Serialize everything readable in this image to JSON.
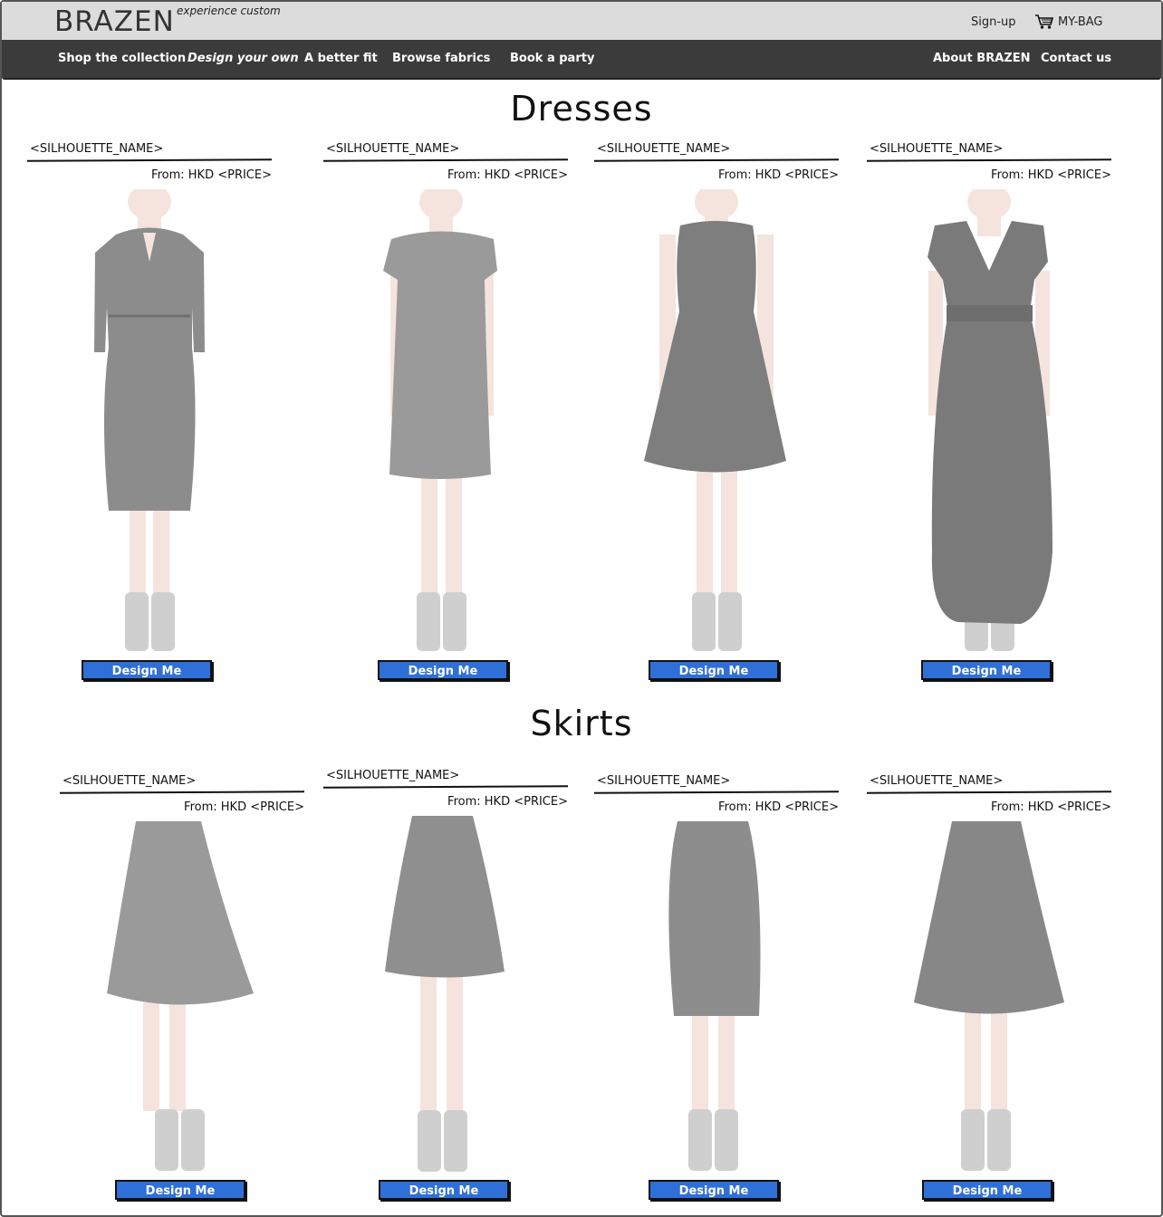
{
  "header": {
    "logo": "BRAZEN",
    "tagline": "experience custom",
    "signup": "Sign-up",
    "bag": "MY-BAG",
    "icons": {
      "cart": "shopping-cart-icon"
    }
  },
  "nav": {
    "left": [
      "Shop the collection",
      "Design your own",
      "A better fit",
      "Browse fabrics",
      "Book a party"
    ],
    "right": [
      "About BRAZEN",
      "Contact us"
    ]
  },
  "sections": [
    {
      "title": "Dresses",
      "items": [
        {
          "name": "<SILHOUETTE_NAME>",
          "price": "From: HKD <PRICE>",
          "button": "Design Me",
          "style": "sheath dress with sleeves"
        },
        {
          "name": "<SILHOUETTE_NAME>",
          "price": "From: HKD <PRICE>",
          "button": "Design Me",
          "style": "shift dress"
        },
        {
          "name": "<SILHOUETTE_NAME>",
          "price": "From: HKD <PRICE>",
          "button": "Design Me",
          "style": "fit and flare dress"
        },
        {
          "name": "<SILHOUETTE_NAME>",
          "price": "From: HKD <PRICE>",
          "button": "Design Me",
          "style": "wrap maxi dress"
        }
      ]
    },
    {
      "title": "Skirts",
      "items": [
        {
          "name": "<SILHOUETTE_NAME>",
          "price": "From: HKD <PRICE>",
          "button": "Design Me",
          "style": "flared midi skirt"
        },
        {
          "name": "<SILHOUETTE_NAME>",
          "price": "From: HKD <PRICE>",
          "button": "Design Me",
          "style": "a-line skirt"
        },
        {
          "name": "<SILHOUETTE_NAME>",
          "price": "From: HKD <PRICE>",
          "button": "Design Me",
          "style": "pencil skirt"
        },
        {
          "name": "<SILHOUETTE_NAME>",
          "price": "From: HKD <PRICE>",
          "button": "Design Me",
          "style": "pleated midi skirt"
        }
      ]
    }
  ],
  "colors": {
    "button": "#2f6fd8",
    "nav_bg": "#3b3b3b",
    "header_bg": "#dcdcdc",
    "garment": "#8a8a8a",
    "skin": "#f3e3dc"
  }
}
